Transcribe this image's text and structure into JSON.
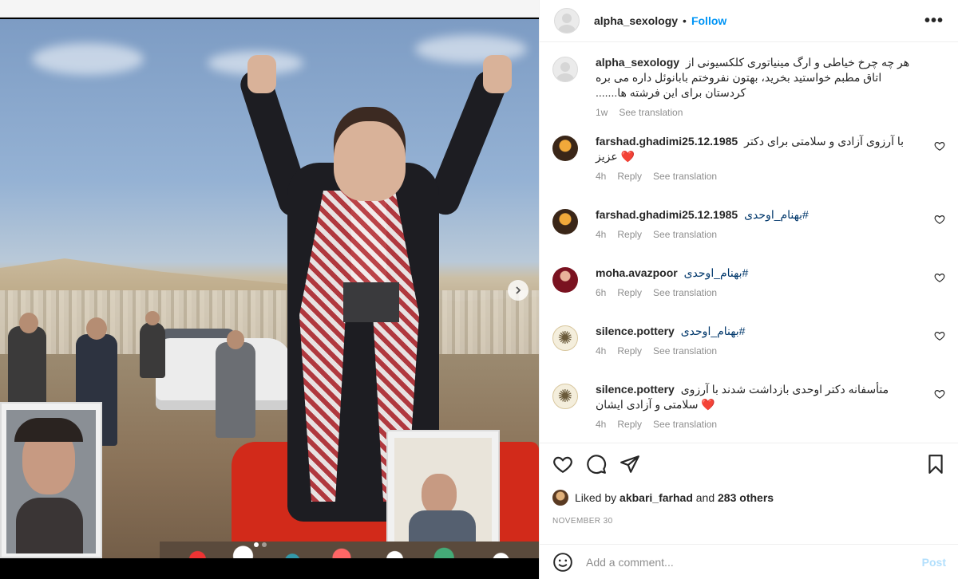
{
  "post": {
    "username": "alpha_sexology",
    "follow_label": "Follow",
    "separator": "•",
    "more_label": "•••",
    "caption": {
      "username": "alpha_sexology",
      "text": "هر چه چرخ خیاطی و ارگ مینیاتوری کلکسیونی از اتاق مطبم خواستید بخرید، بهتون نفروختم بابانوئل داره می بره کردستان برای این فرشته ها.......",
      "time": "1w",
      "see_translation": "See translation"
    },
    "comments": [
      {
        "username": "farshad.ghadimi25.12.1985",
        "text": "با آرزوی آزادی و سلامتی برای دکتر عزیز",
        "emoji": "❤️",
        "hashtag": "",
        "time": "4h",
        "reply": "Reply",
        "see_translation": "See translation",
        "avatar": "dark"
      },
      {
        "username": "farshad.ghadimi25.12.1985",
        "text": "",
        "emoji": "",
        "hashtag": "#بهنام_اوحدی",
        "time": "4h",
        "reply": "Reply",
        "see_translation": "See translation",
        "avatar": "dark"
      },
      {
        "username": "moha.avazpoor",
        "text": "",
        "emoji": "",
        "hashtag": "#بهنام_اوحدی",
        "time": "6h",
        "reply": "Reply",
        "see_translation": "See translation",
        "avatar": "red"
      },
      {
        "username": "silence.pottery",
        "text": "",
        "emoji": "",
        "hashtag": "#بهنام_اوحدی",
        "time": "4h",
        "reply": "Reply",
        "see_translation": "See translation",
        "avatar": "pottery"
      },
      {
        "username": "silence.pottery",
        "text": "متأسفانه دکتر اوحدی بازداشت شدند با آرزوی سلامتی و آزادی ایشان",
        "emoji": "❤️",
        "hashtag": "",
        "time": "4h",
        "reply": "Reply",
        "see_translation": "See translation",
        "avatar": "pottery"
      }
    ],
    "liked_by_prefix": "Liked by",
    "liked_by_user": "akbari_farhad",
    "liked_by_and": "and",
    "liked_by_others": "283 others",
    "date": "NOVEMBER 30",
    "comment_placeholder": "Add a comment...",
    "post_label": "Post",
    "carousel": {
      "current": 1,
      "total": 2
    },
    "colors": {
      "accent": "#0095f6",
      "post_disabled": "#b2dffc",
      "hashtag": "#00376b",
      "heart": "#ed4956"
    }
  }
}
